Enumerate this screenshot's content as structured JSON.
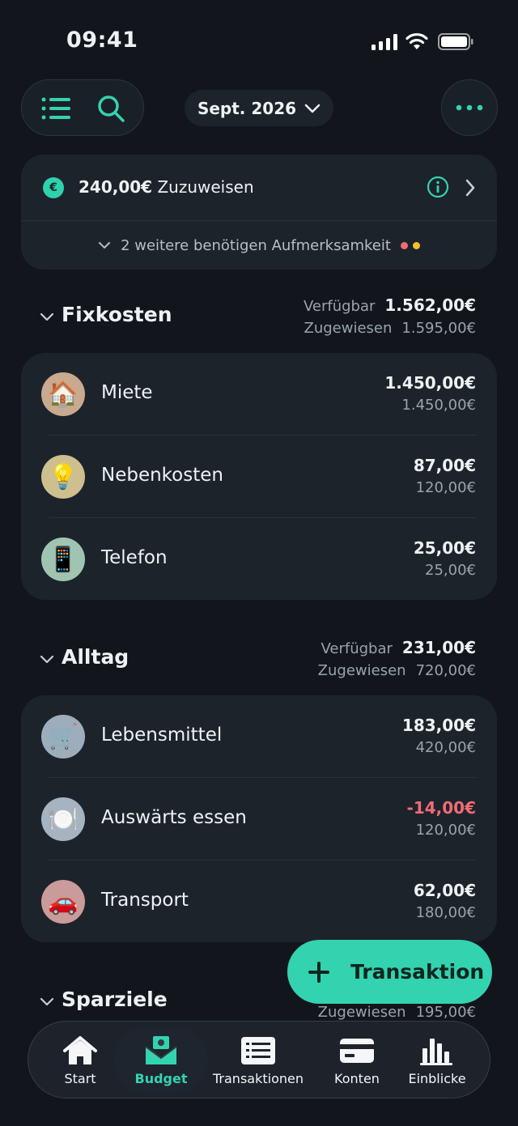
{
  "status_bar": {
    "time": "09:41"
  },
  "header": {
    "month": "Sept. 2026"
  },
  "assign": {
    "currency_symbol": "€",
    "amount": "240,00€",
    "label": "Zuzuweisen",
    "attention_text": "2 weitere benötigen Aufmerksamkeit",
    "attention_dot_colors": [
      "#f06c75",
      "#f3c02f"
    ]
  },
  "sections": [
    {
      "title": "Fixkosten",
      "available_label": "Verfügbar",
      "available": "1.562,00€",
      "assigned_label": "Zugewiesen",
      "assigned": "1.595,00€",
      "items": [
        {
          "name": "Miete",
          "icon": "house-icon",
          "available": "1.450,00€",
          "assigned": "1.450,00€"
        },
        {
          "name": "Nebenkosten",
          "icon": "lightbulb-icon",
          "available": "87,00€",
          "assigned": "120,00€"
        },
        {
          "name": "Telefon",
          "icon": "phone-icon",
          "available": "25,00€",
          "assigned": "25,00€"
        }
      ]
    },
    {
      "title": "Alltag",
      "available_label": "Verfügbar",
      "available": "231,00€",
      "assigned_label": "Zugewiesen",
      "assigned": "720,00€",
      "items": [
        {
          "name": "Lebensmittel",
          "icon": "cart-icon",
          "available": "183,00€",
          "assigned": "420,00€"
        },
        {
          "name": "Auswärts essen",
          "icon": "plate-icon",
          "available": "-14,00€",
          "assigned": "120,00€"
        },
        {
          "name": "Transport",
          "icon": "car-icon",
          "available": "62,00€",
          "assigned": "180,00€"
        }
      ]
    },
    {
      "title": "Sparziele",
      "assigned_label": "Zugewiesen",
      "assigned": "195,00€"
    }
  ],
  "fab": {
    "label": "Transaktion"
  },
  "tabbar": {
    "tabs": [
      {
        "label": "Start",
        "icon": "home-icon"
      },
      {
        "label": "Budget",
        "icon": "budget-envelope-icon",
        "active": true
      },
      {
        "label": "Transaktionen",
        "icon": "list-icon"
      },
      {
        "label": "Konten",
        "icon": "card-icon"
      },
      {
        "label": "Einblicke",
        "icon": "bar-chart-icon"
      }
    ]
  },
  "colors": {
    "accent": "#34d3b0",
    "negative": "#f06c75",
    "background": "#12161c",
    "card": "#1d232b"
  }
}
